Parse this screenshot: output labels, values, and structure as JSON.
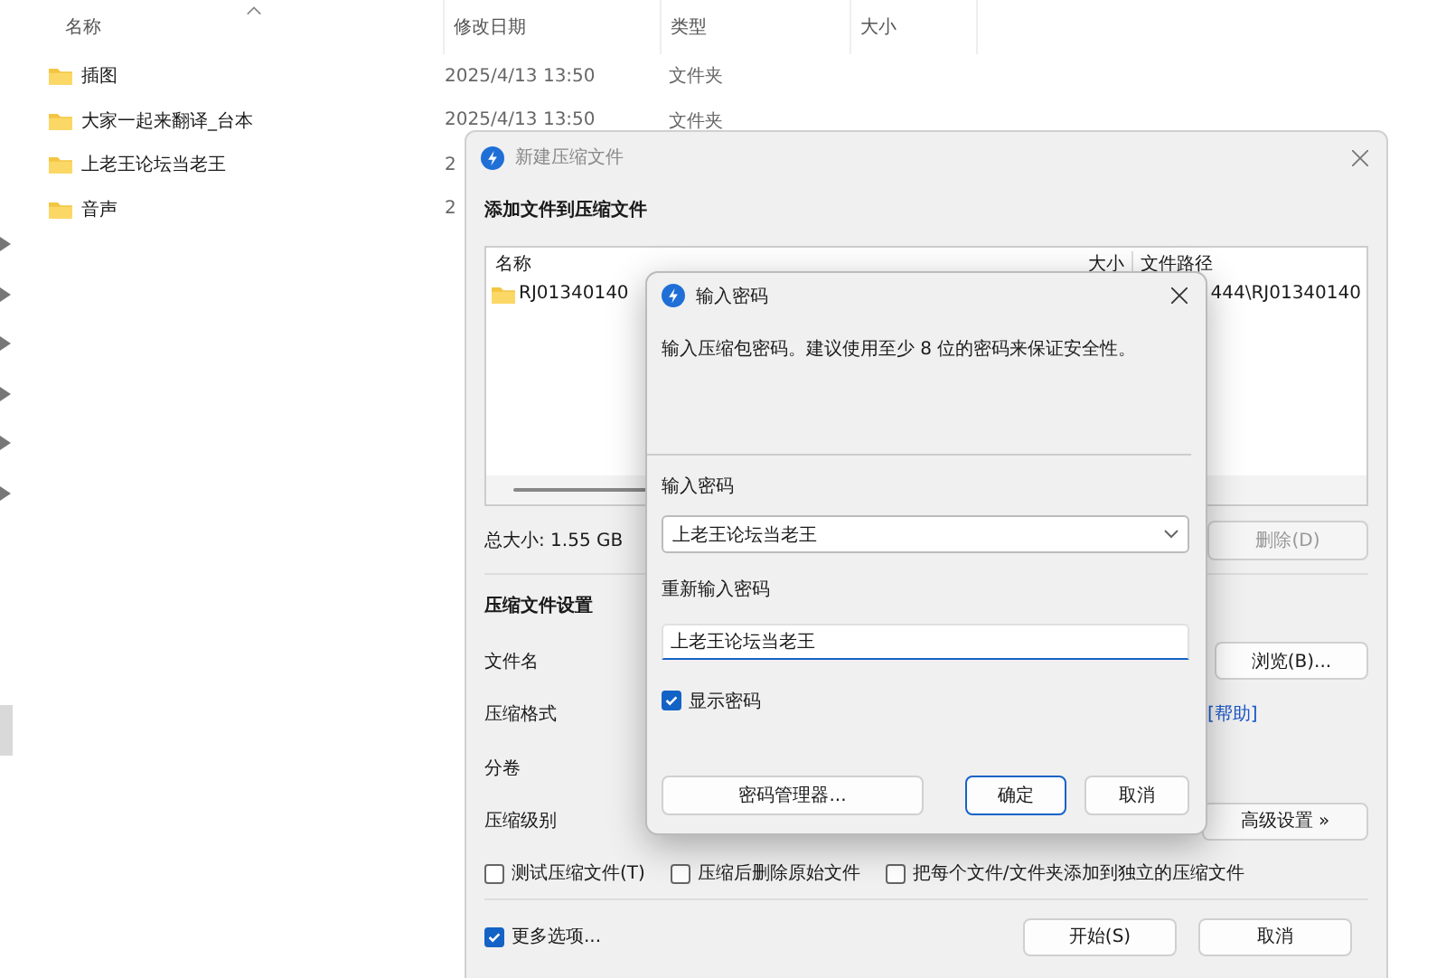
{
  "explorer": {
    "columns": [
      {
        "label": "名称",
        "sorted": true
      },
      {
        "label": "修改日期",
        "sorted": false
      },
      {
        "label": "类型",
        "sorted": false
      },
      {
        "label": "大小",
        "sorted": false
      }
    ],
    "files": [
      {
        "name": "插图",
        "date": "2025/4/13 13:50",
        "type": "文件夹"
      },
      {
        "name": "大家一起来翻译_台本",
        "date": "2025/4/13 13:50",
        "type": "文件夹"
      },
      {
        "name": "上老王论坛当老王",
        "date": "2"
      },
      {
        "name": "音声",
        "date": "2"
      }
    ]
  },
  "archive_dialog": {
    "title": "新建压缩文件",
    "active": false,
    "heading": "添加文件到压缩文件",
    "list": {
      "columns": [
        "名称",
        "大小",
        "文件路径"
      ],
      "rows": [
        {
          "name": "RJ01340140",
          "path": "444\\RJ01340140"
        }
      ]
    },
    "total_size": "总大小: 1.55 GB",
    "delete_button": {
      "label": "删除(D)",
      "disabled": true
    },
    "settings_heading": "压缩文件设置",
    "fields": [
      {
        "label": "文件名",
        "action": {
          "kind": "button",
          "label": "浏览(B)..."
        }
      },
      {
        "label": "压缩格式",
        "action": {
          "kind": "link",
          "label": "[帮助]"
        }
      },
      {
        "label": "分卷"
      },
      {
        "label": "压缩级别",
        "action": {
          "kind": "button",
          "label": "高级设置 »"
        }
      }
    ],
    "options": [
      {
        "label": "测试压缩文件(T)",
        "checked": false
      },
      {
        "label": "压缩后删除原始文件",
        "checked": false
      },
      {
        "label": "把每个文件/文件夹添加到独立的压缩文件",
        "checked": false
      }
    ],
    "more_options": {
      "label": "更多选项...",
      "checked": true
    },
    "buttons": [
      {
        "label": "开始(S)"
      },
      {
        "label": "取消"
      }
    ]
  },
  "password_dialog": {
    "title": "输入密码",
    "message": "输入压缩包密码。建议使用至少 8 位的密码来保证安全性。",
    "password_label": "输入密码",
    "password": "上老王论坛当老王",
    "confirm_label": "重新输入密码",
    "confirm": "上老王论坛当老王",
    "show_password": {
      "label": "显示密码",
      "checked": true
    },
    "buttons": [
      {
        "label": "密码管理器...",
        "default": false
      },
      {
        "label": "确定",
        "default": true
      },
      {
        "label": "取消",
        "default": false
      }
    ]
  }
}
